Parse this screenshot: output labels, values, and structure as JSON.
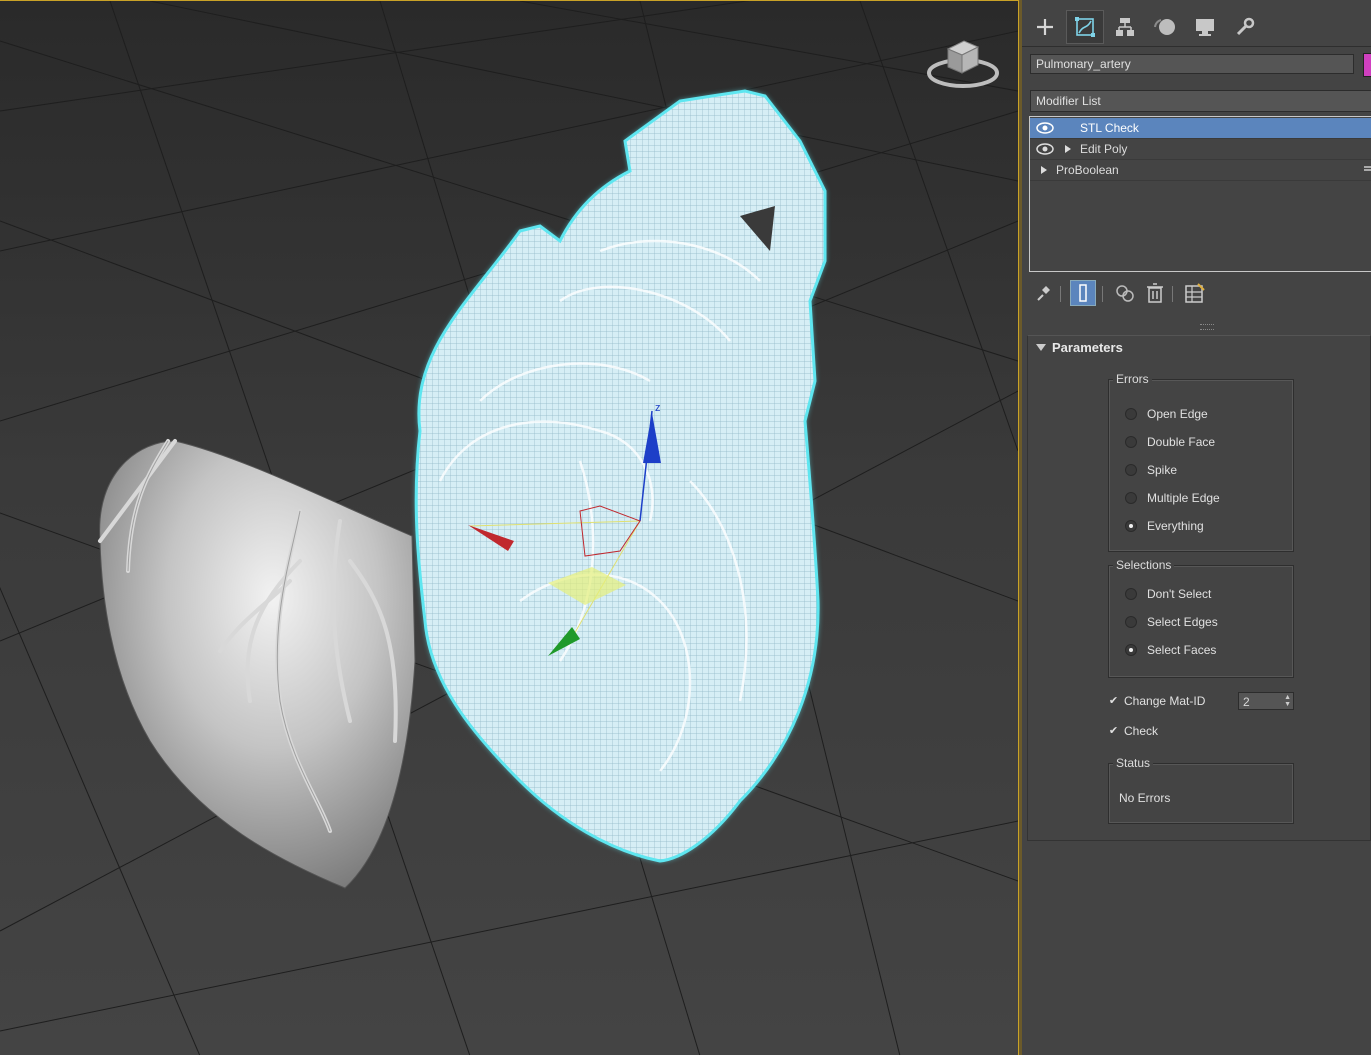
{
  "command_panel": {
    "tabs": [
      {
        "name": "create",
        "icon": "plus-icon",
        "active": false
      },
      {
        "name": "modify",
        "icon": "modify-icon",
        "active": true
      },
      {
        "name": "hierarchy",
        "icon": "hierarchy-icon",
        "active": false
      },
      {
        "name": "motion",
        "icon": "motion-icon",
        "active": false
      },
      {
        "name": "display",
        "icon": "display-icon",
        "active": false
      },
      {
        "name": "utilities",
        "icon": "wrench-icon",
        "active": false
      }
    ],
    "object_name": "Pulmonary_artery",
    "object_color": "#d040c0",
    "modifier_list_label": "Modifier List",
    "stack": [
      {
        "label": "STL Check",
        "selected": true
      },
      {
        "label": "Edit Poly",
        "selected": false
      },
      {
        "label": "ProBoolean",
        "selected": false
      }
    ]
  },
  "parameters": {
    "title": "Parameters",
    "errors": {
      "title": "Errors",
      "options": [
        "Open Edge",
        "Double Face",
        "Spike",
        "Multiple Edge",
        "Everything"
      ],
      "selected": "Everything"
    },
    "selections": {
      "title": "Selections",
      "options": [
        "Don't Select",
        "Select Edges",
        "Select Faces"
      ],
      "selected": "Select Faces"
    },
    "change_mat_id": {
      "label": "Change Mat-ID",
      "checked": true,
      "value": "2"
    },
    "check": {
      "label": "Check",
      "checked": true
    },
    "status": {
      "title": "Status",
      "text": "No Errors"
    }
  },
  "colors": {
    "selection_outline": "#5ee6f0",
    "gizmo_x": "#c0282e",
    "gizmo_y": "#1f9a2a",
    "gizmo_z": "#1d3fc8",
    "highlight": "#5b85bd"
  }
}
